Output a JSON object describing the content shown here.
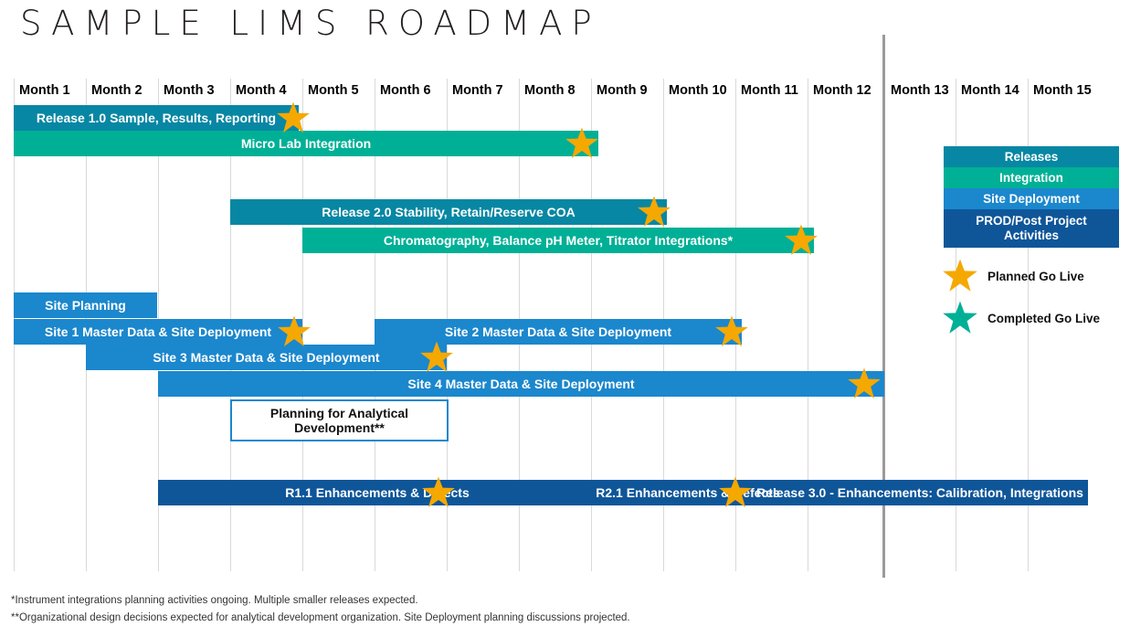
{
  "title": "SAMPLE LIMS ROADMAP",
  "colors": {
    "releases": "#0787a3",
    "integration": "#00b096",
    "site_deployment": "#1b87cd",
    "prod_post_project": "#0f5699",
    "planned_star": "#f5a800",
    "completed_star": "#00b096",
    "gridline": "#d9d9d9",
    "divider": "#9a9a9a"
  },
  "timeline": {
    "months": [
      "Month 1",
      "Month 2",
      "Month 3",
      "Month 4",
      "Month 5",
      "Month 6",
      "Month 7",
      "Month 8",
      "Month 9",
      "Month 10",
      "Month 11",
      "Month 12",
      "Month 13",
      "Month 14",
      "Month 15"
    ],
    "divider_after_month": 12
  },
  "chart_data": {
    "type": "bar",
    "title": "SAMPLE LIMS ROADMAP",
    "xlabel": "",
    "ylabel": "",
    "categories": [
      "Month 1",
      "Month 2",
      "Month 3",
      "Month 4",
      "Month 5",
      "Month 6",
      "Month 7",
      "Month 8",
      "Month 9",
      "Month 10",
      "Month 11",
      "Month 12",
      "Month 13",
      "Month 14",
      "Month 15"
    ],
    "legend": [
      {
        "label": "Releases",
        "color": "#0787a3"
      },
      {
        "label": "Integration",
        "color": "#00b096"
      },
      {
        "label": "Site Deployment",
        "color": "#1b87cd"
      },
      {
        "label": "PROD/Post Project Activities",
        "color": "#0f5699"
      }
    ],
    "markers": [
      {
        "label": "Planned Go Live",
        "color": "#f5a800"
      },
      {
        "label": "Completed Go Live",
        "color": "#00b096"
      }
    ],
    "tasks": [
      {
        "label": "Release 1.0 Sample, Results, Reporting",
        "category": "Releases",
        "start_month": 1,
        "end_month": 4.85,
        "milestone": {
          "type": "Planned Go Live",
          "at_month": 4.8
        }
      },
      {
        "label": "Micro Lab Integration",
        "category": "Integration",
        "start_month": 1,
        "end_month": 9.2,
        "milestone": {
          "type": "Planned Go Live",
          "at_month": 9.0
        }
      },
      {
        "label": "Release 2.0 Stability, Retain/Reserve COA",
        "category": "Releases",
        "start_month": 4.1,
        "end_month": 10.2,
        "milestone": {
          "type": "Planned Go Live",
          "at_month": 10.0
        }
      },
      {
        "label": "Chromatography, Balance pH Meter, Titrator Integrations*",
        "category": "Integration",
        "start_month": 5.1,
        "end_month": 12.2,
        "milestone": {
          "type": "Planned Go Live",
          "at_month": 12.0
        }
      },
      {
        "label": "Site Planning",
        "category": "Site Deployment",
        "start_month": 1,
        "end_month": 3.1,
        "milestone": null
      },
      {
        "label": "Site 1 Master Data & Site Deployment",
        "category": "Site Deployment",
        "start_month": 1,
        "end_month": 5.1,
        "milestone": {
          "type": "Planned Go Live",
          "at_month": 4.85
        }
      },
      {
        "label": "Site 2 Master Data & Site Deployment",
        "category": "Site Deployment",
        "start_month": 6.1,
        "end_month": 11.2,
        "milestone": {
          "type": "Planned Go Live",
          "at_month": 11.0
        }
      },
      {
        "label": "Site 3 Master Data & Site Deployment",
        "category": "Site Deployment",
        "start_month": 2.1,
        "end_month": 7.1,
        "milestone": {
          "type": "Planned Go Live",
          "at_month": 6.9
        }
      },
      {
        "label": "Site 4 Master Data & Site Deployment",
        "category": "Site Deployment",
        "start_month": 3.1,
        "end_month": 13.0,
        "milestone": {
          "type": "Planned Go Live",
          "at_month": 12.7
        }
      },
      {
        "label": "Planning for Analytical Development**",
        "category": "Outline",
        "start_month": 4.1,
        "end_month": 7.2,
        "milestone": null
      },
      {
        "label": "R1.1 Enhancements & Defects",
        "category": "PROD/Post Project Activities",
        "start_month": 3.1,
        "end_month": 16.2,
        "milestone": {
          "type": "Planned Go Live",
          "at_month": 7.0
        }
      }
    ],
    "bottom_bar_segments": [
      "R1.1 Enhancements & Defects",
      "R2.1 Enhancements & Defects",
      "Release 3.0 - Enhancements: Calibration, Integrations"
    ]
  },
  "bars": {
    "release_1_0": "Release 1.0 Sample, Results, Reporting",
    "micro_lab": "Micro Lab Integration",
    "release_2_0": "Release 2.0 Stability, Retain/Reserve COA",
    "chromatography": "Chromatography, Balance pH Meter, Titrator Integrations*",
    "site_planning": "Site Planning",
    "site_1": "Site 1 Master Data & Site Deployment",
    "site_2": "Site 2 Master Data & Site Deployment",
    "site_3": "Site 3 Master Data & Site Deployment",
    "site_4": "Site 4 Master Data & Site Deployment",
    "planning_analytical_line1": "Planning for Analytical",
    "planning_analytical_line2": "Development**",
    "r11": "R1.1 Enhancements & Defects",
    "r21": "R2.1 Enhancements & Defects",
    "release_3_0": "Release 3.0 - Enhancements: Calibration, Integrations"
  },
  "legend": {
    "releases": "Releases",
    "integration": "Integration",
    "site_deployment": "Site Deployment",
    "prod_line1": "PROD/Post Project",
    "prod_line2": "Activities",
    "planned_go_live": "Planned Go Live",
    "completed_go_live": "Completed Go Live"
  },
  "footnotes": {
    "one": "*Instrument integrations planning activities ongoing. Multiple smaller releases expected.",
    "two": "**Organizational design decisions expected for analytical development organization. Site Deployment planning discussions projected."
  }
}
